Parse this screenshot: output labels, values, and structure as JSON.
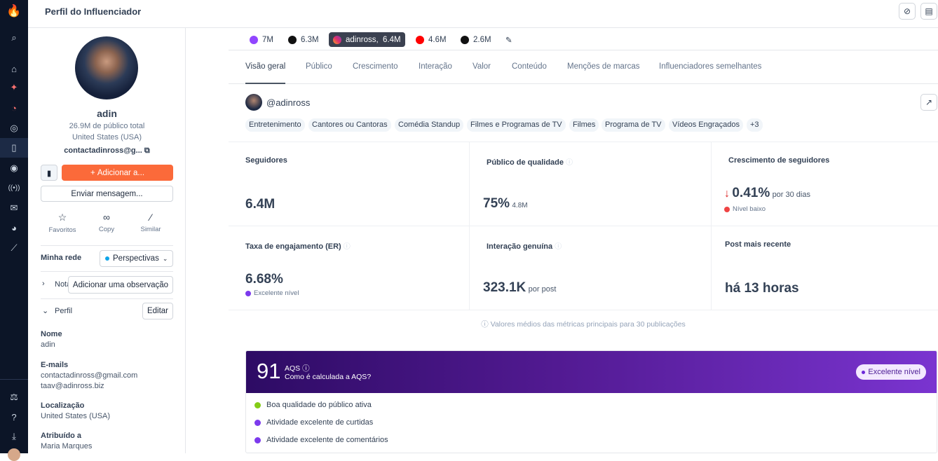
{
  "header": {
    "title": "Perfil do Influenciador"
  },
  "profile": {
    "name": "adin",
    "audience": "26.9M de público total",
    "country": "United States (USA)",
    "email_short": "contactadinross@g...",
    "add_button": "Adicionar a...",
    "message_button": "Enviar mensagem...",
    "actions": [
      {
        "label": "Favoritos",
        "icon": "star-icon"
      },
      {
        "label": "Copy",
        "icon": "link-icon"
      },
      {
        "label": "Similar",
        "icon": "magic-wand-icon"
      }
    ],
    "network_label": "Minha rede",
    "network_value": "Perspectivas",
    "notes_label": "Nota",
    "notes_button": "Adicionar uma observação",
    "profile_label": "Perfil",
    "edit_button": "Editar",
    "fields": [
      {
        "label": "Nome",
        "values": [
          "adin"
        ]
      },
      {
        "label": "E-mails",
        "values": [
          "contactadinross@gmail.com",
          "taav@adinross.biz"
        ]
      },
      {
        "label": "Localização",
        "values": [
          "United States (USA)"
        ]
      },
      {
        "label": "Atribuído a",
        "values": [
          "Maria Marques"
        ]
      }
    ]
  },
  "social": [
    {
      "label": "7M",
      "color": "#9146ff",
      "icon": "twitch-icon"
    },
    {
      "label": "6.3M",
      "color": "#111111",
      "icon": "tiktok-icon"
    },
    {
      "label": "adinross,  6.4M",
      "color": "#e1306c",
      "icon": "instagram-icon"
    },
    {
      "label": "4.6M",
      "color": "#ff0000",
      "icon": "youtube-icon"
    },
    {
      "label": "2.6M",
      "color": "#111111",
      "icon": "x-icon"
    }
  ],
  "tabs": [
    "Visão geral",
    "Público",
    "Crescimento",
    "Interação",
    "Valor",
    "Conteúdo",
    "Menções de marcas",
    "Influenciadores semelhantes"
  ],
  "handle": "@adinross",
  "tags": [
    "Entretenimento",
    "Cantores ou Cantoras",
    "Comédia Standup",
    "Filmes e Programas de TV",
    "Filmes",
    "Programa de TV",
    "Vídeos Engraçados",
    "+3"
  ],
  "metrics": {
    "followers": {
      "label": "Seguidores",
      "value": "6.4M"
    },
    "quality": {
      "label": "Público de qualidade",
      "value": "75%",
      "sub": "4.8M"
    },
    "growth": {
      "label": "Crescimento de seguidores",
      "value": "0.41%",
      "sub": "por 30 dias",
      "level": "Nível baixo",
      "level_color": "#ef4444"
    },
    "er": {
      "label": "Taxa de engajamento (ER)",
      "value": "6.68%",
      "level": "Excelente nível",
      "level_color": "#7c3aed"
    },
    "genuine": {
      "label": "Interação genuína",
      "value": "323.1K",
      "sub": "por post"
    },
    "recent": {
      "label": "Post mais recente",
      "value": "há 13 horas"
    }
  },
  "footnote": "Valores médios das métricas principais para 30 publicações",
  "aqs": {
    "score": "91",
    "label": "AQS",
    "link": "Como é calculada a AQS?",
    "badge": "Excelente nível",
    "items": [
      {
        "text": "Boa qualidade do público ativa",
        "color": "#84cc16"
      },
      {
        "text": "Atividade excelente de curtidas",
        "color": "#7c3aed"
      },
      {
        "text": "Atividade excelente de comentários",
        "color": "#7c3aed"
      }
    ]
  }
}
